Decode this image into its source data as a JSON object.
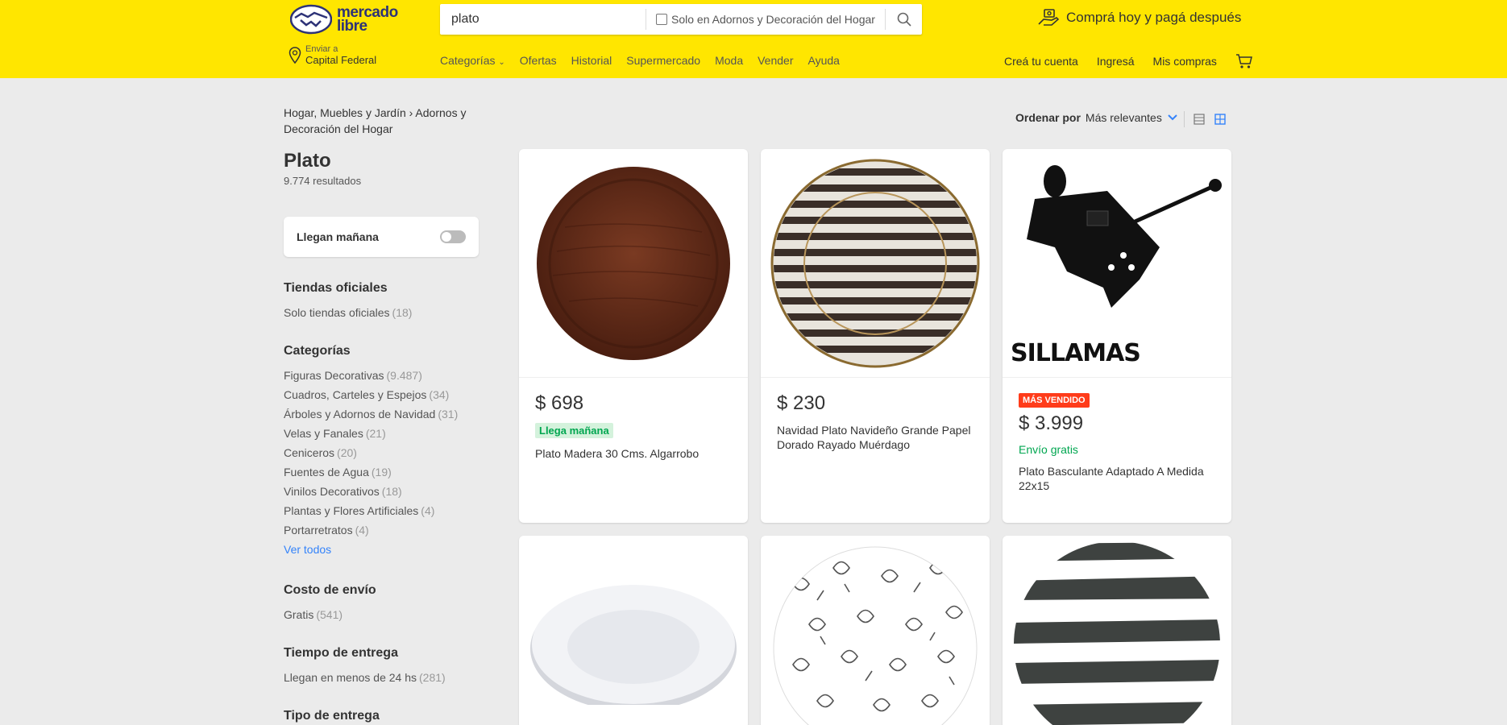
{
  "header": {
    "logo_line1": "mercado",
    "logo_line2": "libre",
    "search_value": "plato",
    "search_scope": "Solo en Adornos y Decoración del Hogar",
    "promo": "Comprá hoy y pagá después",
    "location_small": "Enviar a",
    "location_main": "Capital Federal",
    "nav": [
      "Categorías",
      "Ofertas",
      "Historial",
      "Supermercado",
      "Moda",
      "Vender",
      "Ayuda"
    ],
    "user_nav": [
      "Creá tu cuenta",
      "Ingresá",
      "Mis compras"
    ]
  },
  "sidebar": {
    "breadcrumb_1": "Hogar, Muebles y Jardín",
    "breadcrumb_2": "Adornos y Decoración del Hogar",
    "title": "Plato",
    "results": "9.774 resultados",
    "toggle_label": "Llegan mañana",
    "official_title": "Tiendas oficiales",
    "official_item": {
      "label": "Solo tiendas oficiales",
      "count": "(18)"
    },
    "categories_title": "Categorías",
    "categories": [
      {
        "label": "Figuras Decorativas",
        "count": "(9.487)"
      },
      {
        "label": "Cuadros, Carteles y Espejos",
        "count": "(34)"
      },
      {
        "label": "Árboles y Adornos de Navidad",
        "count": "(31)"
      },
      {
        "label": "Velas y Fanales",
        "count": "(21)"
      },
      {
        "label": "Ceniceros",
        "count": "(20)"
      },
      {
        "label": "Fuentes de Agua",
        "count": "(19)"
      },
      {
        "label": "Vinilos Decorativos",
        "count": "(18)"
      },
      {
        "label": "Plantas y Flores Artificiales",
        "count": "(4)"
      },
      {
        "label": "Portarretratos",
        "count": "(4)"
      }
    ],
    "see_all": "Ver todos",
    "shipping_cost_title": "Costo de envío",
    "shipping_cost_item": {
      "label": "Gratis",
      "count": "(541)"
    },
    "delivery_time_title": "Tiempo de entrega",
    "delivery_time_item": {
      "label": "Llegan en menos de 24 hs",
      "count": "(281)"
    },
    "delivery_type_title": "Tipo de entrega"
  },
  "sort": {
    "label": "Ordenar por",
    "value": "Más relevantes"
  },
  "products": [
    {
      "price": "$ 698",
      "badge": "Llega mañana",
      "title": "Plato Madera 30 Cms. Algarrobo"
    },
    {
      "price": "$ 230",
      "title": "Navidad Plato Navideño Grande Papel Dorado Rayado Muérdago"
    },
    {
      "tag": "MÁS VENDIDO",
      "price": "$ 3.999",
      "shipping": "Envío gratis",
      "title": "Plato Basculante Adaptado A Medida 22x15",
      "brand": "SILLAMAS"
    }
  ],
  "colors": {
    "brand_yellow": "#ffe600",
    "accent_blue": "#3483fa",
    "green": "#00a650",
    "red": "#ff3c1a"
  }
}
